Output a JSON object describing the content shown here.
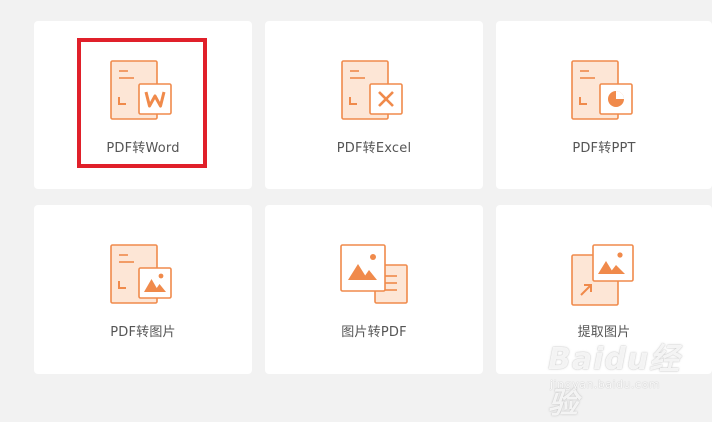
{
  "colors": {
    "accent": "#f08a4b",
    "accent_light": "#fde6d6",
    "card_bg": "#ffffff",
    "page_bg": "#f2f2f2",
    "label": "#555555",
    "highlight": "#e0202a"
  },
  "tools": [
    {
      "label": "PDF转Word",
      "icon": "pdf-to-word-icon"
    },
    {
      "label": "PDF转Excel",
      "icon": "pdf-to-excel-icon"
    },
    {
      "label": "PDF转PPT",
      "icon": "pdf-to-ppt-icon"
    },
    {
      "label": "PDF转图片",
      "icon": "pdf-to-image-icon"
    },
    {
      "label": "图片转PDF",
      "icon": "image-to-pdf-icon"
    },
    {
      "label": "提取图片",
      "icon": "extract-image-icon"
    }
  ],
  "watermark": {
    "logo": "Baidu经验",
    "url": "jingyan.baidu.com"
  }
}
